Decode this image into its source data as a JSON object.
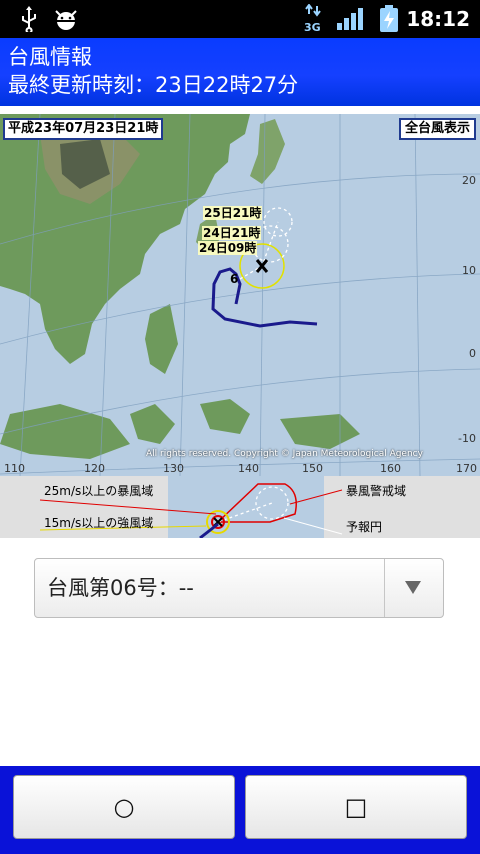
{
  "status_bar": {
    "time": "18:12",
    "network_label": "3G",
    "icons": [
      "usb-icon",
      "android-debug-icon",
      "data-transfer-icon",
      "signal-icon",
      "battery-charging-icon"
    ]
  },
  "header": {
    "title": "台風情報",
    "updated": "最終更新時刻：23日22時27分"
  },
  "map": {
    "date_label": "平成23年07月23日21時",
    "all_typhoon_button": "全台風表示",
    "copyright": "All rights reserved. Copyright © Japan Meteorological Agency",
    "lon_labels": [
      "110",
      "120",
      "130",
      "140",
      "150",
      "160",
      "170"
    ],
    "lat_labels": [
      "20",
      "10",
      "0",
      "-10"
    ],
    "forecast_labels": [
      "25日21時",
      "24日21時",
      "24日09時"
    ],
    "typhoon_number_marker": "6",
    "colors": {
      "track": "#1a1a8c",
      "storm_area": "#e1e100",
      "sea": "#b9cfe3"
    }
  },
  "legend": {
    "storm_25ms": "25m/s以上の暴風域",
    "storm_15ms": "15m/s以上の強風域",
    "warning_area": "暴風警戒域",
    "forecast_circle": "予報円",
    "colors": {
      "storm": "#e00000",
      "strong": "#e6d800",
      "forecast": "#ffffff"
    }
  },
  "selector": {
    "value": "台風第06号：--"
  },
  "buttons": {
    "left_label": "○",
    "right_label": "□"
  }
}
